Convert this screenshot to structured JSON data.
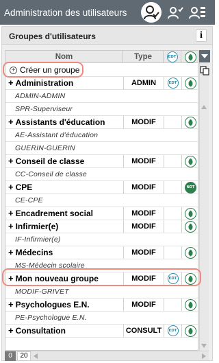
{
  "window": {
    "title": "Administration des utilisateurs",
    "icons": [
      "user-check-icon",
      "users-check-icon",
      "user-list-icon"
    ]
  },
  "panel": {
    "title": "Groupes d'utilisateurs",
    "info_label": "i"
  },
  "grid": {
    "columns": {
      "name": "Nom",
      "type": "Type",
      "edt": "EDT",
      "sens": "leaf-icon"
    },
    "create_label": "Créer un groupe",
    "rows": [
      {
        "kind": "group",
        "name": "Administration",
        "type": "ADMIN",
        "edt": true,
        "sens": true
      },
      {
        "kind": "member",
        "name": "ADMIN-ADMIN"
      },
      {
        "kind": "member",
        "name": "SPR-Superviseur"
      },
      {
        "kind": "group",
        "name": "Assistants d'éducation",
        "type": "MODIF",
        "edt": false,
        "sens": true
      },
      {
        "kind": "member",
        "name": "AE-Assistant d'éducation"
      },
      {
        "kind": "member",
        "name": "GUERIN-GUERIN"
      },
      {
        "kind": "group",
        "name": "Conseil de classe",
        "type": "MODIF",
        "edt": false,
        "sens": true
      },
      {
        "kind": "member",
        "name": "CC-Conseil de classe"
      },
      {
        "kind": "group",
        "name": "CPE",
        "type": "MODIF",
        "edt": false,
        "sens": "NOT"
      },
      {
        "kind": "member",
        "name": "CE-CPE"
      },
      {
        "kind": "group",
        "name": "Encadrement social",
        "type": "MODIF",
        "edt": false,
        "sens": true
      },
      {
        "kind": "group",
        "name": "Infirmier(e)",
        "type": "MODIF",
        "edt": false,
        "sens": true
      },
      {
        "kind": "member",
        "name": "IF-Infirmier(e)"
      },
      {
        "kind": "group",
        "name": "Médecins",
        "type": "MODIF",
        "edt": false,
        "sens": true
      },
      {
        "kind": "member",
        "name": "MS-Médecin scolaire"
      },
      {
        "kind": "group",
        "name": "Mon nouveau groupe",
        "type": "MODIF",
        "edt": true,
        "sens": true
      },
      {
        "kind": "member",
        "name": "MODIF-GRIVET"
      },
      {
        "kind": "group",
        "name": "Psychologues E.N.",
        "type": "MODIF",
        "edt": false,
        "sens": true
      },
      {
        "kind": "member",
        "name": "PE-Psychologue E.N."
      },
      {
        "kind": "group",
        "name": "Consultation",
        "type": "CONSULT",
        "edt": true,
        "sens": true
      }
    ]
  },
  "footer": {
    "selected_count": "0",
    "total_count": "20"
  },
  "colors": {
    "titlebar": "#5f6a73",
    "highlight": "#f08a7e",
    "edt": "#2a8db0",
    "sens": "#2f7f4f"
  }
}
